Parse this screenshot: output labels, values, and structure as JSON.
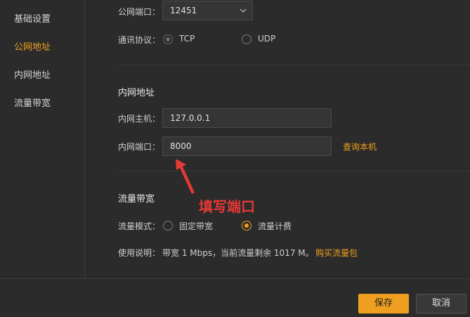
{
  "sidebar": {
    "items": [
      {
        "label": "基础设置",
        "active": false
      },
      {
        "label": "公网地址",
        "active": true
      },
      {
        "label": "内网地址",
        "active": false
      },
      {
        "label": "流量带宽",
        "active": false
      }
    ]
  },
  "public": {
    "port_label": "公网端口：",
    "port_value": "12451",
    "protocol_label": "通讯协议：",
    "protocol_options": [
      "TCP",
      "UDP"
    ],
    "protocol_selected": "TCP"
  },
  "internal": {
    "title": "内网地址",
    "host_label": "内网主机：",
    "host_value": "127.0.0.1",
    "port_label": "内网端口：",
    "port_value": "8000",
    "query_link": "查询本机"
  },
  "bandwidth": {
    "title": "流量带宽",
    "mode_label": "流量模式：",
    "mode_options": [
      "固定带宽",
      "流量计费"
    ],
    "mode_selected": "流量计费",
    "usage_label": "使用说明：",
    "usage_text": "带宽 1 Mbps，当前流量剩余 1017 M。",
    "buy_link": "购买流量包"
  },
  "annotation": {
    "text": "填写端口",
    "color": "#e53935"
  },
  "footer": {
    "save_label": "保存",
    "cancel_label": "取消"
  },
  "colors": {
    "accent": "#f0a020",
    "background": "#2b2b2b"
  }
}
